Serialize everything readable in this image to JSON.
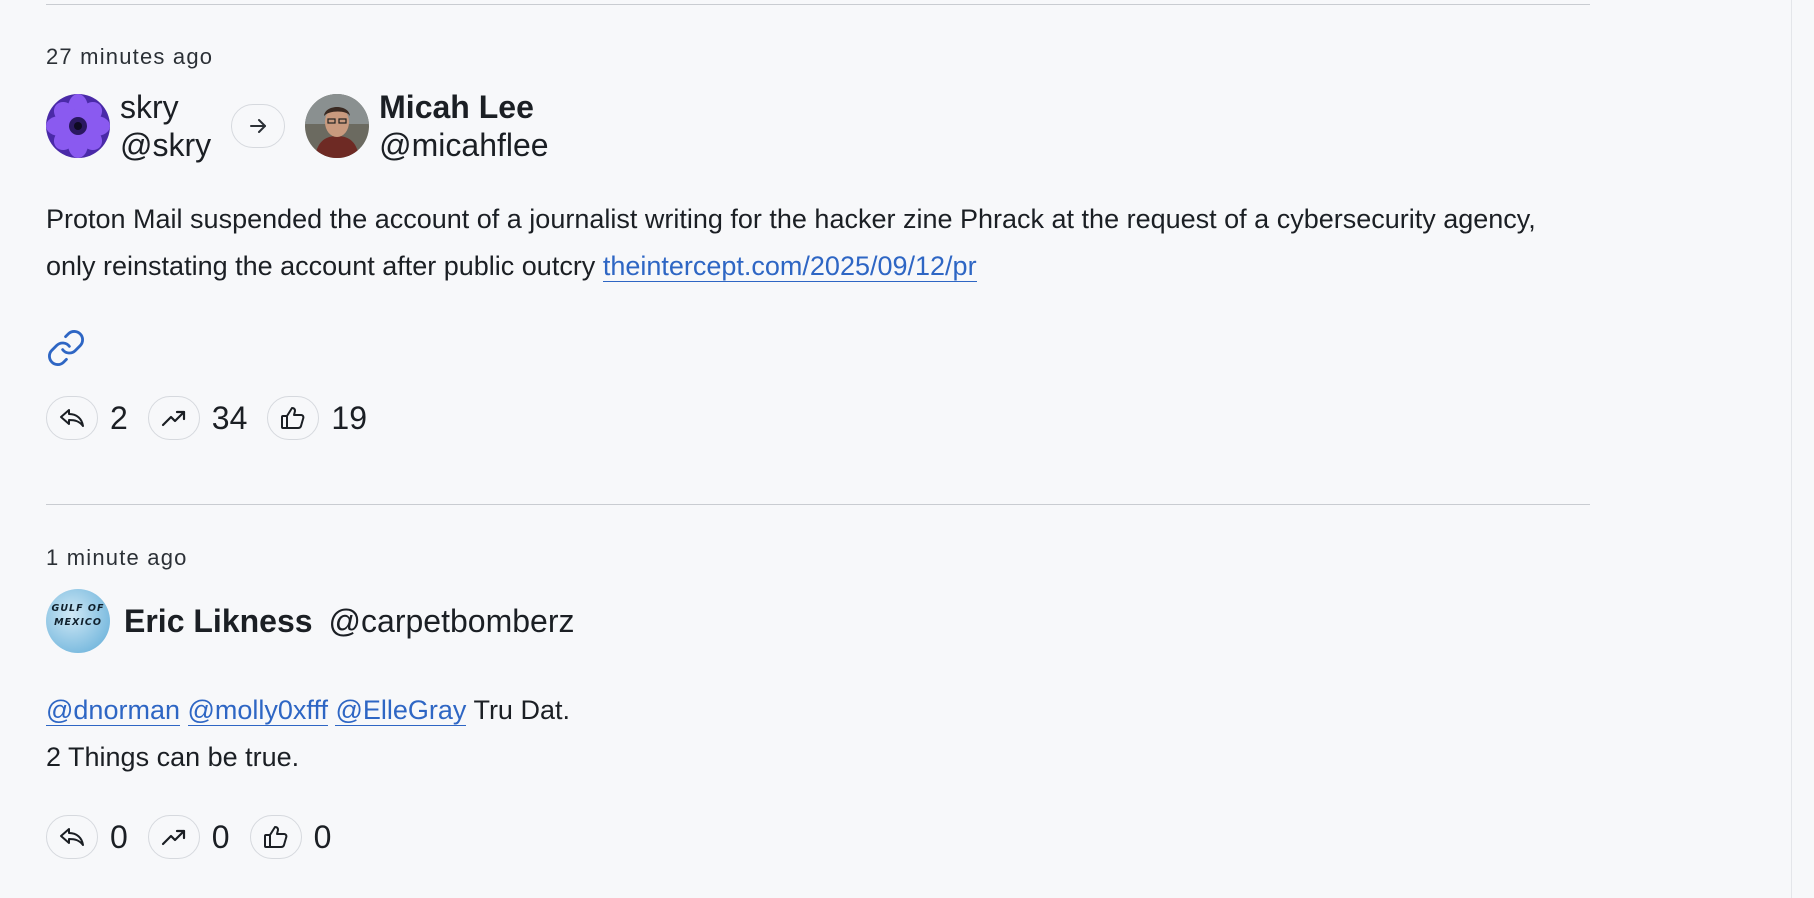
{
  "posts": [
    {
      "time": "27 minutes ago",
      "booster": {
        "name": "skry",
        "handle": "@skry"
      },
      "author": {
        "name": "Micah Lee",
        "handle": "@micahflee"
      },
      "text": "Proton Mail suspended the account of a journalist writing for the hacker zine Phrack at the request of a cybersecurity agency, only reinstating the account after public outcry ",
      "link": "theintercept.com/2025/09/12/pr",
      "counts": {
        "replies": "2",
        "boosts": "34",
        "likes": "19"
      }
    },
    {
      "time": "1 minute ago",
      "author": {
        "name": "Eric Likness",
        "handle": "@carpetbomberz",
        "avatar_text_1": "GULF OF",
        "avatar_text_2": "MEXICO"
      },
      "mentions": [
        "@dnorman",
        "@molly0xfff",
        "@ElleGray"
      ],
      "text_after_mentions": "Tru Dat.",
      "text_line2": "2 Things can be true.",
      "counts": {
        "replies": "0",
        "boosts": "0",
        "likes": "0"
      }
    }
  ],
  "icons": {
    "boost_arrow": "arrow-right-icon",
    "link": "link-icon",
    "reply": "reply-icon",
    "boost": "trending-up-icon",
    "like": "thumbs-up-icon"
  },
  "colors": {
    "accent": "#2e66c4",
    "background": "#f7f8fa",
    "border": "#d6d9de"
  }
}
